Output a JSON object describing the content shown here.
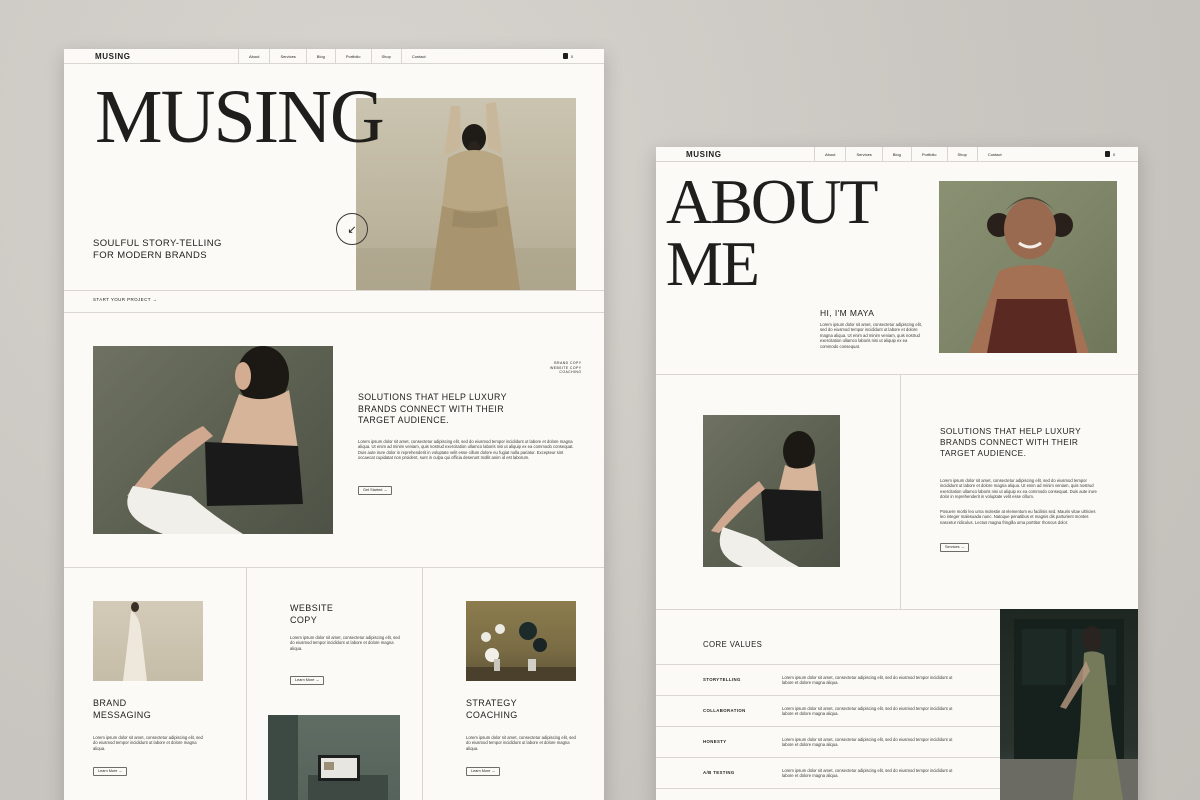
{
  "left_page": {
    "brand": "MUSING",
    "nav": [
      "About",
      "Services",
      "Blog",
      "Portfolio",
      "Shop",
      "Contact"
    ],
    "cart_count": "0",
    "hero_title": "MUSING",
    "tagline_line1": "SOULFUL STORY-TELLING",
    "tagline_line2": "FOR MODERN BRANDS",
    "cta": "START YOUR PROJECT →",
    "side_list": [
      "BRAND COPY",
      "WEBSITE COPY",
      "COACHING"
    ],
    "solutions_line1": "SOLUTIONS THAT HELP LUXURY",
    "solutions_line2": "BRANDS CONNECT WITH THEIR",
    "solutions_line3": "TARGET AUDIENCE.",
    "solutions_body": "Lorem ipsum dolor sit amet, consectetur adipiscing elit, sed do eiusmod tempor incididunt ut labore et dolore magna aliqua. Ut enim ad minim veniam, quis nostrud exercitation ullamco laboris nisi ut aliquip ex ea commodo consequat. Duis aute irure dolor in reprehenderit in voluptate velit esse cillum dolore eu fugiat nulla pariatur. Excepteur sint occaecat cupidatat non proident, sunt in culpa qui officia deserunt mollit anim id est laborum.",
    "get_started": "Get Started →",
    "website_copy_line1": "WEBSITE",
    "website_copy_line2": "COPY",
    "website_copy_body": "Lorem ipsum dolor sit amet, consectetur adipiscing elit, sed do eiusmod tempor incididunt ut labore et dolore magna aliqua.",
    "learn_more": "Learn More →",
    "brand_messaging_line1": "BRAND",
    "brand_messaging_line2": "MESSAGING",
    "brand_messaging_body": "Lorem ipsum dolor sit amet, consectetur adipiscing elit, sed do eiusmod tempor incididunt ut labore et dolore magna aliqua.",
    "strategy_line1": "STRATEGY",
    "strategy_line2": "COACHING",
    "strategy_body": "Lorem ipsum dolor sit amet, consectetur adipiscing elit, sed do eiusmod tempor incididunt ut labore et dolore magna aliqua."
  },
  "right_page": {
    "brand": "MUSING",
    "nav": [
      "About",
      "Services",
      "Blog",
      "Portfolio",
      "Shop",
      "Contact"
    ],
    "cart_count": "0",
    "title_line1": "ABOUT",
    "title_line2": "ME",
    "greeting": "HI, I'M MAYA",
    "greeting_body": "Lorem ipsum dolor sit amet, consectetur adipiscing elit, sed do eiusmod tempor incididunt ut labore et dolore magna aliqua. Ut enim ad minim veniam, quis nostrud exercitation ullamco laboris nisi ut aliquip ex ea commodo consequat.",
    "solutions_line1": "SOLUTIONS THAT HELP LUXURY",
    "solutions_line2": "BRANDS CONNECT WITH THEIR",
    "solutions_line3": "TARGET AUDIENCE.",
    "solutions_body1": "Lorem ipsum dolor sit amet, consectetur adipiscing elit, sed do eiusmod tempor incididunt ut labore et dolore magna aliqua. Ut enim ad minim veniam, quis nostrud exercitation ullamco laboris nisi ut aliquip ex ea commodo consequat. Duis aute irure dolor in reprehenderit in voluptate velit esse cillum.",
    "solutions_body2": "Posuere morbi leo urna molestie at elementum eu facilisis sed. Mauris vitae ultricies leo integer malesuada nunc. Natoque penatibus et magnis dis parturient montes nascetur ridiculus. Lectus magna fringilla urna porttitor rhoncus dolor.",
    "services_btn": "Services →",
    "core_values_title": "CORE VALUES",
    "values": [
      {
        "name": "STORYTELLING",
        "text": "Lorem ipsum dolor sit amet, consectetur adipiscing elit, sed do eiusmod tempor incididunt ut labore et dolore magna aliqua."
      },
      {
        "name": "COLLABORATION",
        "text": "Lorem ipsum dolor sit amet, consectetur adipiscing elit, sed do eiusmod tempor incididunt ut labore et dolore magna aliqua."
      },
      {
        "name": "HONESTY",
        "text": "Lorem ipsum dolor sit amet, consectetur adipiscing elit, sed do eiusmod tempor incididunt ut labore et dolore magna aliqua."
      },
      {
        "name": "A/B TESTING",
        "text": "Lorem ipsum dolor sit amet, consectetur adipiscing elit, sed do eiusmod tempor incididunt ut labore et dolore magna aliqua."
      }
    ]
  }
}
